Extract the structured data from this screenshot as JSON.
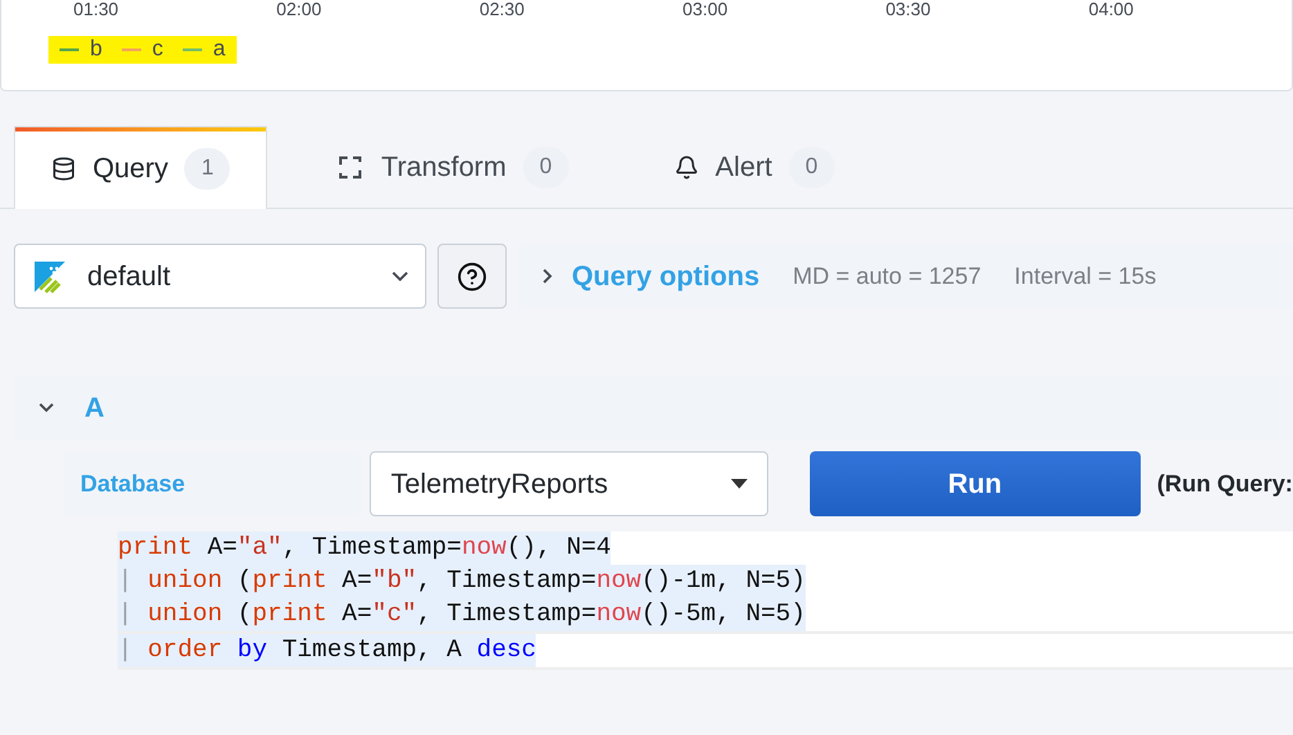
{
  "graph": {
    "time_ticks": [
      "01:30",
      "02:00",
      "02:30",
      "03:00",
      "03:30",
      "04:00"
    ],
    "legend": [
      {
        "label": "b",
        "color": "#56a64b"
      },
      {
        "label": "c",
        "color": "#f2a45c"
      },
      {
        "label": "a",
        "color": "#73bf69"
      }
    ]
  },
  "tabs": [
    {
      "label": "Query",
      "count": "1",
      "kind": "database",
      "selected": true
    },
    {
      "label": "Transform",
      "count": "0",
      "kind": "transform",
      "selected": false
    },
    {
      "label": "Alert",
      "count": "0",
      "kind": "bell",
      "selected": false
    }
  ],
  "datasource": {
    "value": "default"
  },
  "query_options": {
    "label": "Query options",
    "md": "MD = auto = 1257",
    "interval": "Interval = 15s"
  },
  "query": {
    "name": "A",
    "expanded": true,
    "database_label": "Database",
    "database": "TelemetryReports",
    "run_button": "Run",
    "run_hint": "(Run Query:",
    "lines": [
      {
        "selected": true,
        "current": false,
        "tokens": [
          {
            "text": "print",
            "kind": "keyword"
          },
          {
            "text": " A=",
            "kind": "plain"
          },
          {
            "text": "\"a\"",
            "kind": "string"
          },
          {
            "text": ", Timestamp=",
            "kind": "plain"
          },
          {
            "text": "now",
            "kind": "function"
          },
          {
            "text": "(), N=4",
            "kind": "plain"
          }
        ]
      },
      {
        "selected": true,
        "current": false,
        "tokens": [
          {
            "text": "|",
            "kind": "pipe"
          },
          {
            "text": " union",
            "kind": "keyword"
          },
          {
            "text": " (",
            "kind": "plain"
          },
          {
            "text": "print",
            "kind": "keyword"
          },
          {
            "text": " A=",
            "kind": "plain"
          },
          {
            "text": "\"b\"",
            "kind": "string"
          },
          {
            "text": ", Timestamp=",
            "kind": "plain"
          },
          {
            "text": "now",
            "kind": "function"
          },
          {
            "text": "()-1m, N=5)",
            "kind": "plain"
          }
        ]
      },
      {
        "selected": true,
        "current": false,
        "tokens": [
          {
            "text": "|",
            "kind": "pipe"
          },
          {
            "text": " union",
            "kind": "keyword"
          },
          {
            "text": " (",
            "kind": "plain"
          },
          {
            "text": "print",
            "kind": "keyword"
          },
          {
            "text": " A=",
            "kind": "plain"
          },
          {
            "text": "\"c\"",
            "kind": "string"
          },
          {
            "text": ", Timestamp=",
            "kind": "plain"
          },
          {
            "text": "now",
            "kind": "function"
          },
          {
            "text": "()-5m, N=5)",
            "kind": "plain"
          }
        ]
      },
      {
        "selected": true,
        "current": true,
        "tokens": [
          {
            "text": "|",
            "kind": "pipe"
          },
          {
            "text": " order",
            "kind": "keyword"
          },
          {
            "text": " by",
            "kind": "operator"
          },
          {
            "text": " Timestamp, A ",
            "kind": "plain"
          },
          {
            "text": "desc",
            "kind": "operator"
          }
        ]
      }
    ]
  }
}
